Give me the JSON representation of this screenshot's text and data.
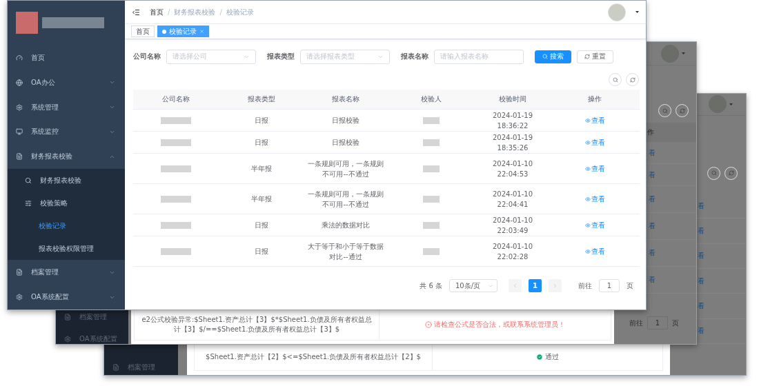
{
  "main_window": {
    "sidebar": {
      "items": [
        {
          "label": "首页",
          "kind": "link"
        },
        {
          "label": "OA办公",
          "kind": "submenu",
          "expanded": false
        },
        {
          "label": "系统管理",
          "kind": "submenu",
          "expanded": false
        },
        {
          "label": "系统监控",
          "kind": "submenu",
          "expanded": false
        },
        {
          "label": "财务报表校验",
          "kind": "submenu",
          "expanded": true,
          "children": [
            {
              "label": "财务报表校验",
              "selected": false
            },
            {
              "label": "校验策略",
              "selected": false
            },
            {
              "label": "校验记录",
              "selected": true
            },
            {
              "label": "报表校验权限管理",
              "selected": false
            }
          ]
        },
        {
          "label": "档案管理",
          "kind": "submenu",
          "expanded": false
        },
        {
          "label": "OA系统配置",
          "kind": "submenu",
          "expanded": false
        }
      ]
    },
    "breadcrumb": [
      "首页",
      "财务报表校验",
      "校验记录"
    ],
    "breadcrumb_separator": "/",
    "tabs": [
      {
        "label": "首页",
        "selected": false
      },
      {
        "label": "校验记录",
        "selected": true
      }
    ],
    "filters": [
      {
        "label": "公司名称",
        "placeholder": "请选择公司",
        "kind": "select"
      },
      {
        "label": "报表类型",
        "placeholder": "请选择报表类型",
        "kind": "select"
      },
      {
        "label": "报表名称",
        "placeholder": "请输入报表名称",
        "kind": "input"
      }
    ],
    "buttons": [
      {
        "label": "搜索",
        "kind": "primary"
      },
      {
        "label": "重置",
        "kind": "default"
      }
    ],
    "table": {
      "columns": [
        "公司名称",
        "报表类型",
        "报表名称",
        "校验人",
        "校验时间",
        "操作"
      ],
      "rows": [
        {
          "report_type": "日报",
          "report_name": "日报校验",
          "check_time": "2024-01-19 18:36:22",
          "action": "查看"
        },
        {
          "report_type": "日报",
          "report_name": "日报校验",
          "check_time": "2024-01-19 18:35:26",
          "action": "查看"
        },
        {
          "report_type": "半年报",
          "report_name": "一条规则可用，一条规则不可用--不通过",
          "check_time": "2024-01-10 22:04:53",
          "action": "查看"
        },
        {
          "report_type": "半年报",
          "report_name": "一条规则可用，一条规则不可用--不通过",
          "check_time": "2024-01-10 22:04:41",
          "action": "查看"
        },
        {
          "report_type": "日报",
          "report_name": "乘法的数据对比",
          "check_time": "2024-01-10 22:03:49",
          "action": "查看"
        },
        {
          "report_type": "日报",
          "report_name": "大于等于和小于等于数据对比--通过",
          "check_time": "2024-01-10 22:02:28",
          "action": "查看"
        }
      ]
    },
    "pagination": {
      "total": "共 6 条",
      "page_size": "10条/页",
      "pages": [
        {
          "label": "1",
          "selected": true
        }
      ],
      "goto_label": "前往",
      "goto_value": "1",
      "page_unit": "页"
    }
  },
  "middle_window": {
    "column_header": "作",
    "links": [
      "看",
      "看",
      "看",
      "看",
      "看",
      "看"
    ],
    "sidebar_items": [
      "档案管理",
      "OA系统配置"
    ],
    "dialog_row": {
      "formula": "e2公式校验异常:$Sheet1.资产总计【3】$*$Sheet1.负债及所有者权益总计【3】$/==$Sheet1.负债及所有者权益总计【3】$",
      "result": "请检查公式是否合法，或联系系统管理员！",
      "kind": "error"
    },
    "pagination": {
      "goto_label": "前往",
      "goto_value": "1",
      "page_unit": "页"
    }
  },
  "back_window": {
    "links": [
      "看",
      "看",
      "看",
      "看",
      "看",
      "看"
    ],
    "sidebar_items": [
      "档案管理"
    ],
    "dialog_row": {
      "formula": "$Sheet1.资产总计【2】$<=$Sheet1.负债及所有者权益总计【2】$",
      "result": "通过",
      "kind": "pass"
    }
  }
}
